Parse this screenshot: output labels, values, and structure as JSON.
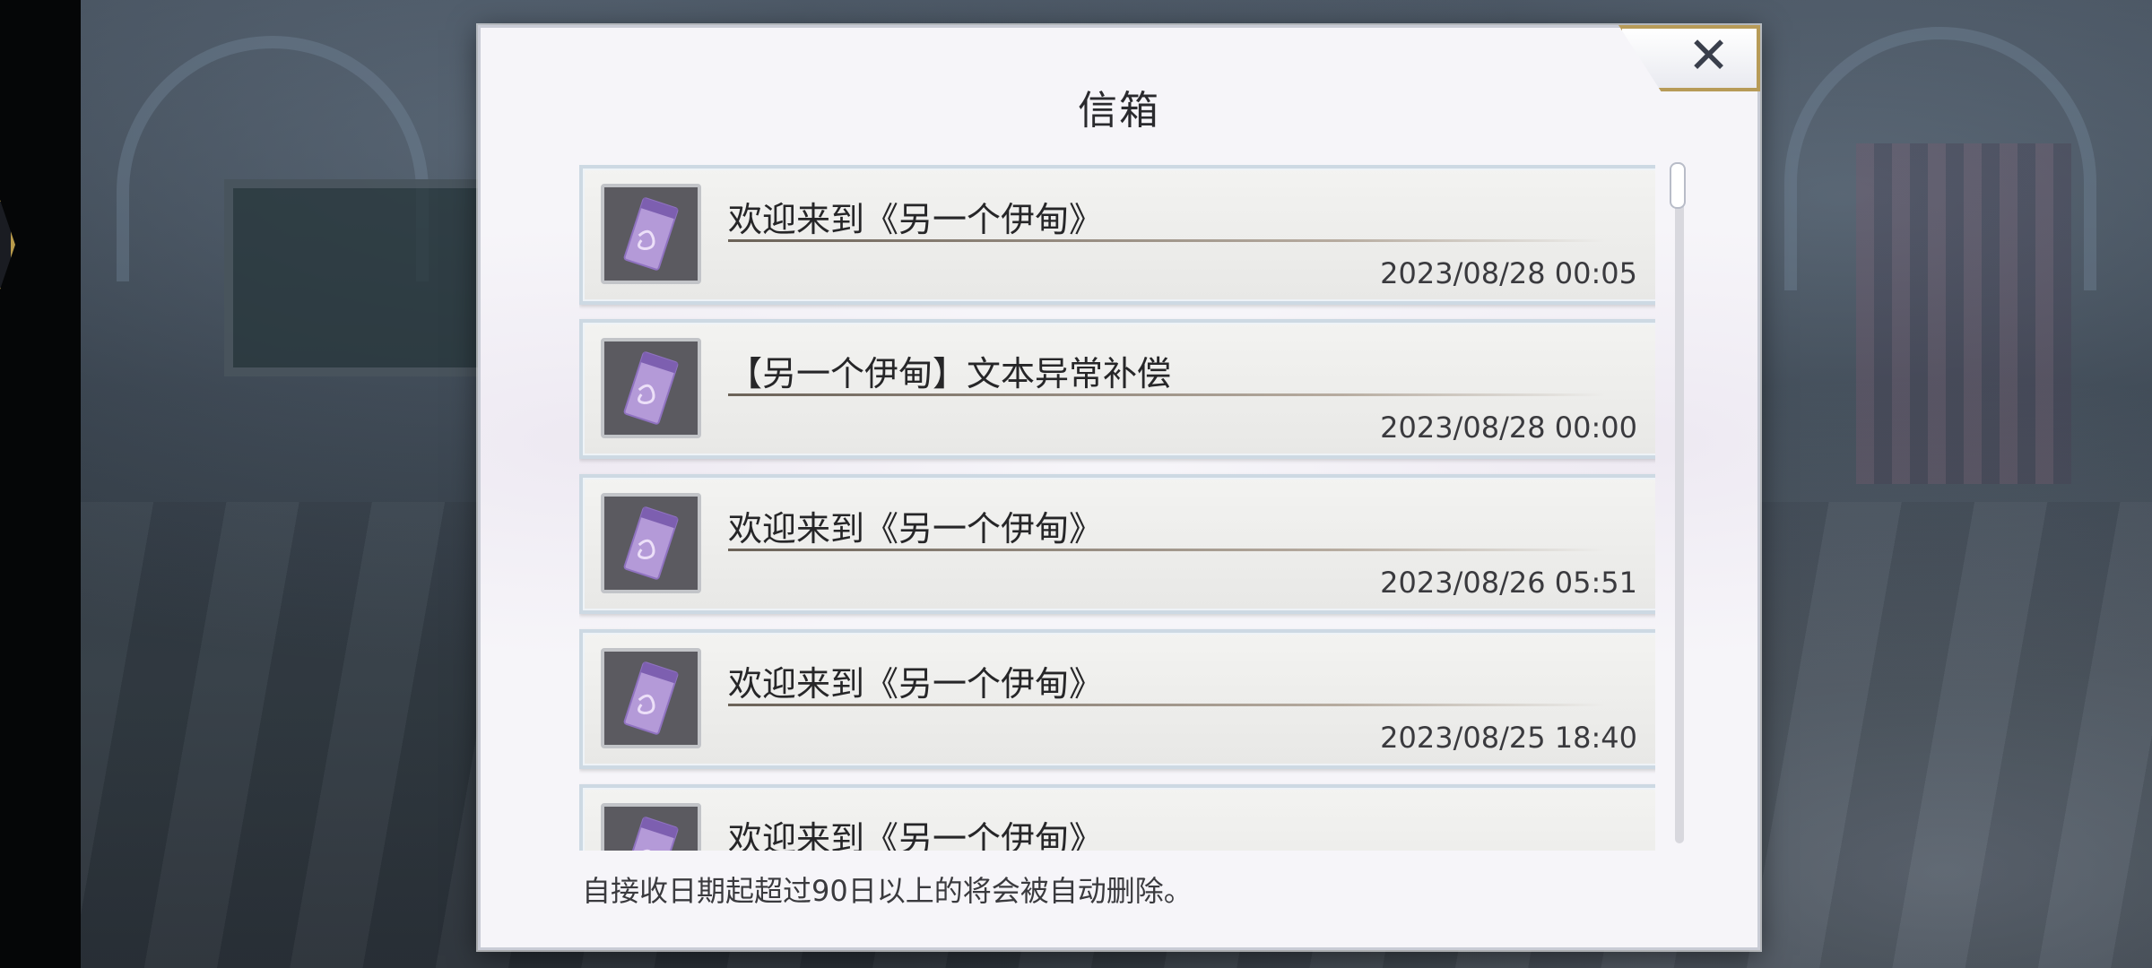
{
  "dialog": {
    "title": "信箱",
    "close_icon": "✕",
    "footer_note": "自接收日期起超过90日以上的将会被自动删除。"
  },
  "mails": [
    {
      "subject": "欢迎来到《另一个伊甸》",
      "date": "2023/08/28 00:05",
      "icon": "purple-ticket-icon"
    },
    {
      "subject": "【另一个伊甸】文本异常补偿",
      "date": "2023/08/28 00:00",
      "icon": "purple-ticket-icon"
    },
    {
      "subject": "欢迎来到《另一个伊甸》",
      "date": "2023/08/26 05:51",
      "icon": "purple-ticket-icon"
    },
    {
      "subject": "欢迎来到《另一个伊甸》",
      "date": "2023/08/25 18:40",
      "icon": "purple-ticket-icon"
    },
    {
      "subject": "欢迎来到《另一个伊甸》",
      "date": "",
      "icon": "purple-ticket-icon"
    }
  ],
  "colors": {
    "ticket": "#b49ad8",
    "accent_gold": "#b79b58"
  }
}
